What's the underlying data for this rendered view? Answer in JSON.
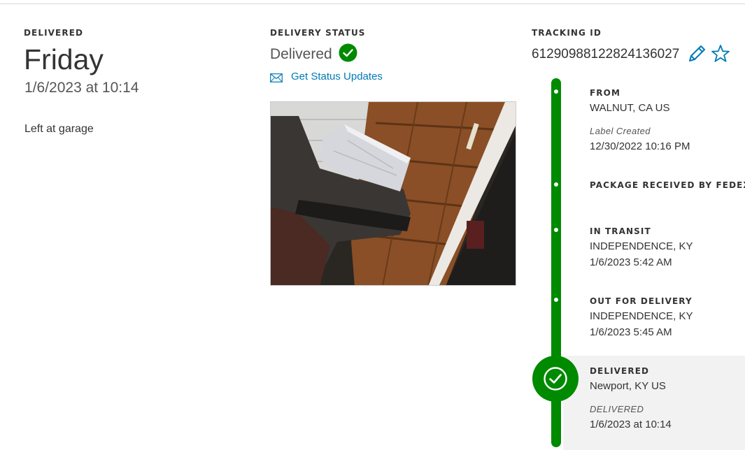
{
  "delivery_summary": {
    "label": "DELIVERED",
    "day": "Friday",
    "datetime": "1/6/2023 at 10:14",
    "note": "Left at garage"
  },
  "status": {
    "label": "DELIVERY STATUS",
    "value": "Delivered",
    "updates_link": "Get Status Updates"
  },
  "tracking": {
    "label": "TRACKING ID",
    "number": "612909881228241360​27"
  },
  "timeline": {
    "from": {
      "title": "FROM",
      "location": "WALNUT, CA US",
      "sublabel": "Label Created",
      "datetime": "12/30/2022 10:16 PM"
    },
    "received": {
      "title": "PACKAGE RECEIVED BY FEDEX"
    },
    "transit": {
      "title": "IN TRANSIT",
      "location": "INDEPENDENCE, KY",
      "datetime": "1/6/2023 5:42 AM"
    },
    "out": {
      "title": "OUT FOR DELIVERY",
      "location": "INDEPENDENCE, KY",
      "datetime": "1/6/2023 5:45 AM"
    },
    "delivered": {
      "title": "DELIVERED",
      "location": "Newport, KY US",
      "sublabel": "DELIVERED",
      "datetime": "1/6/2023 at 10:14"
    }
  },
  "colors": {
    "accent_green": "#008a00",
    "link_blue": "#007ab7",
    "text_dark": "#333333",
    "highlight_bg": "#f2f2f2"
  },
  "icons": [
    "check-circle-icon",
    "mail-icon",
    "pencil-icon",
    "star-icon",
    "delivered-check-icon"
  ]
}
